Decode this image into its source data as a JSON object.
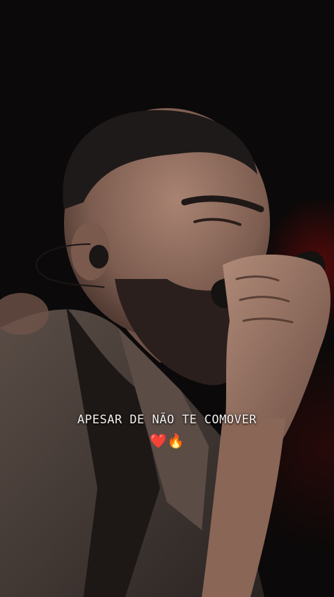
{
  "photo": {
    "subject": "singer with microphone",
    "colors": {
      "background": "#0b0909",
      "skin": "#8a6a5a",
      "beard": "#2a1f1c",
      "hair": "#1e1a19",
      "jacket": "#4a3f3a",
      "stage_light": "#8c0a0a"
    }
  },
  "overlay": {
    "caption": "APESAR DE NÃO TE COMOVER",
    "emojis": [
      {
        "icon": "heart-icon",
        "glyph": "❤️"
      },
      {
        "icon": "fire-icon",
        "glyph": "🔥"
      }
    ]
  }
}
